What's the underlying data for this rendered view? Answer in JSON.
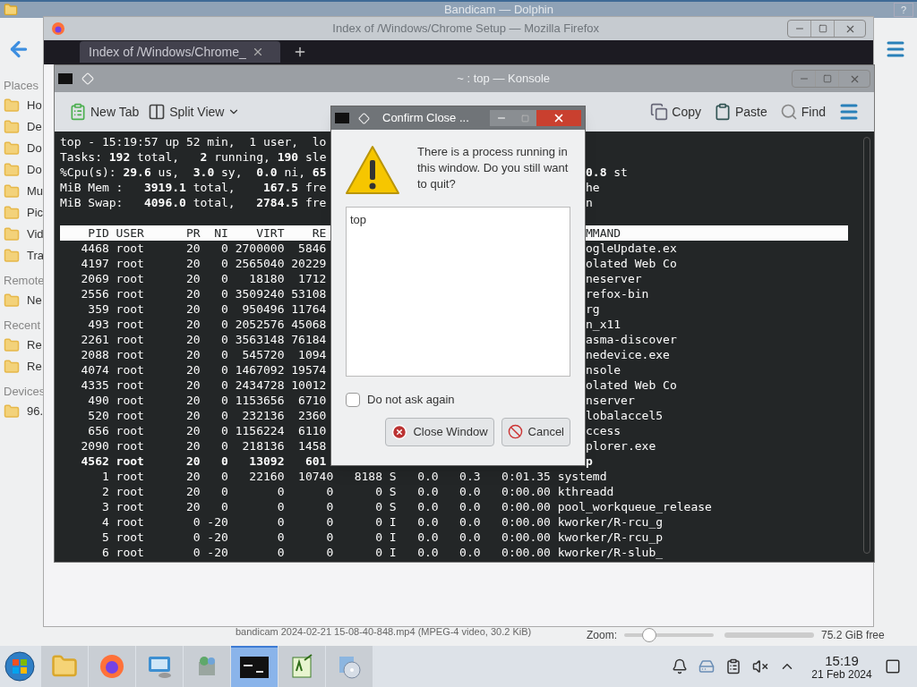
{
  "dolphin": {
    "title": "Bandicam — Dolphin",
    "help_button": "?",
    "sidebar": [
      {
        "kind": "header",
        "label": "Places"
      },
      {
        "kind": "item",
        "label": "Ho"
      },
      {
        "kind": "item",
        "label": "De"
      },
      {
        "kind": "item",
        "label": "Do"
      },
      {
        "kind": "item",
        "label": "Do"
      },
      {
        "kind": "item",
        "label": "Mu"
      },
      {
        "kind": "item",
        "label": "Pic"
      },
      {
        "kind": "item",
        "label": "Vid"
      },
      {
        "kind": "item",
        "label": "Tra"
      },
      {
        "kind": "header",
        "label": "Remote"
      },
      {
        "kind": "item",
        "label": "Ne"
      },
      {
        "kind": "header",
        "label": "Recent"
      },
      {
        "kind": "item",
        "label": "Re"
      },
      {
        "kind": "item",
        "label": "Re"
      },
      {
        "kind": "header",
        "label": "Devices"
      },
      {
        "kind": "item",
        "label": "96."
      }
    ],
    "status": "bandicam 2024-02-21 15-08-40-848.mp4 (MPEG-4 video, 30.2 KiB)",
    "zoom_label": "Zoom:",
    "zoom": {
      "level": 0.28
    },
    "free_space": "75.2 GiB free"
  },
  "firefox": {
    "title": "Index of /Windows/Chrome Setup — Mozilla Firefox",
    "tab": "Index of /Windows/Chrome_"
  },
  "konsole": {
    "title": "~ : top — Konsole",
    "toolbar": [
      "New Tab",
      "Split View",
      "Copy",
      "Paste",
      "Find"
    ],
    "lines": [
      {
        "left": "top - 15:19:57 up 52 min,  1 user,  lo"
      },
      {
        "left": "Tasks: **192** total,   **2** running, **190** sle"
      },
      {
        "left": "%Cpu(s): **29.6** us,  **3.0** sy,  **0.0** ni, **65**",
        "right": "**0.8** st"
      },
      {
        "left": "MiB Mem :   **3919.1** total,    **167.5** fre",
        "right": "he"
      },
      {
        "left": "MiB Swap:   **4096.0** total,   **2784.5** fre",
        "right": "n"
      }
    ],
    "header": {
      "left": "    PID USER      PR  NI    VIRT    RE",
      "right": "MMAND"
    },
    "rows": [
      {
        "left": "   4468 root      20   0 2700000  5846",
        "right": "ogleUpdate.ex",
        "bold": false
      },
      {
        "left": "   4197 root      20   0 2565040 20229",
        "right": "olated Web Co",
        "bold": false
      },
      {
        "left": "   2069 root      20   0   18180  1712",
        "right": "neserver",
        "bold": false
      },
      {
        "left": "   2556 root      20   0 3509240 53108",
        "right": "refox-bin",
        "bold": false
      },
      {
        "left": "    359 root      20   0  950496 11764",
        "right": "rg",
        "bold": false
      },
      {
        "left": "    493 root      20   0 2052576 45068",
        "right": "n_x11",
        "bold": false
      },
      {
        "left": "   2261 root      20   0 3563148 76184",
        "right": "asma-discover",
        "bold": false
      },
      {
        "left": "   2088 root      20   0  545720  1094",
        "right": "nedevice.exe",
        "bold": false
      },
      {
        "left": "   4074 root      20   0 1467092 19574",
        "right": "nsole",
        "bold": false
      },
      {
        "left": "   4335 root      20   0 2434728 10012",
        "right": "olated Web Co",
        "bold": false
      },
      {
        "left": "    490 root      20   0 1153656  6710",
        "right": "nserver",
        "bold": false
      },
      {
        "left": "    520 root      20   0  232136  2360",
        "right": "lobalaccel5",
        "bold": false
      },
      {
        "left": "    656 root      20   0 1156224  6110",
        "right": "ccess",
        "bold": false
      },
      {
        "left": "   2090 root      20   0  218136  1458",
        "right": "plorer.exe",
        "bold": false
      },
      {
        "left": "   4562 root      20   0   13092   601",
        "right": "p",
        "bold": true
      },
      {
        "left": "      1 root      20   0   22160  10740   8188 S   0.0   0.3   0:01.35 systemd",
        "bold": false
      },
      {
        "left": "      2 root      20   0       0      0      0 S   0.0   0.0   0:00.00 kthreadd",
        "bold": false
      },
      {
        "left": "      3 root      20   0       0      0      0 S   0.0   0.0   0:00.00 pool_workqueue_release",
        "bold": false
      },
      {
        "left": "      4 root       0 -20       0      0      0 I   0.0   0.0   0:00.00 kworker/R-rcu_g",
        "bold": false
      },
      {
        "left": "      5 root       0 -20       0      0      0 I   0.0   0.0   0:00.00 kworker/R-rcu_p",
        "bold": false
      },
      {
        "left": "      6 root       0 -20       0      0      0 I   0.0   0.0   0:00.00 kworker/R-slub_",
        "bold": false
      }
    ]
  },
  "dialog": {
    "title": "Confirm Close ...",
    "message": "There is a process running in this window. Do you still want to quit?",
    "processes": [
      "top"
    ],
    "dont_ask": {
      "label": "Do not ask again",
      "checked": false
    },
    "buttons": [
      {
        "kind": "close",
        "label": "Close Window"
      },
      {
        "kind": "cancel",
        "label": "Cancel"
      }
    ]
  },
  "taskbar": {
    "apps": [
      {
        "kind": "folder",
        "selected": false
      },
      {
        "kind": "firefox",
        "selected": false
      },
      {
        "kind": "monitor",
        "selected": false
      },
      {
        "kind": "package",
        "selected": false
      },
      {
        "kind": "terminal",
        "selected": true
      },
      {
        "kind": "editor",
        "selected": false
      },
      {
        "kind": "disc",
        "selected": false
      }
    ],
    "time": "15:19",
    "date": "21 Feb 2024"
  }
}
